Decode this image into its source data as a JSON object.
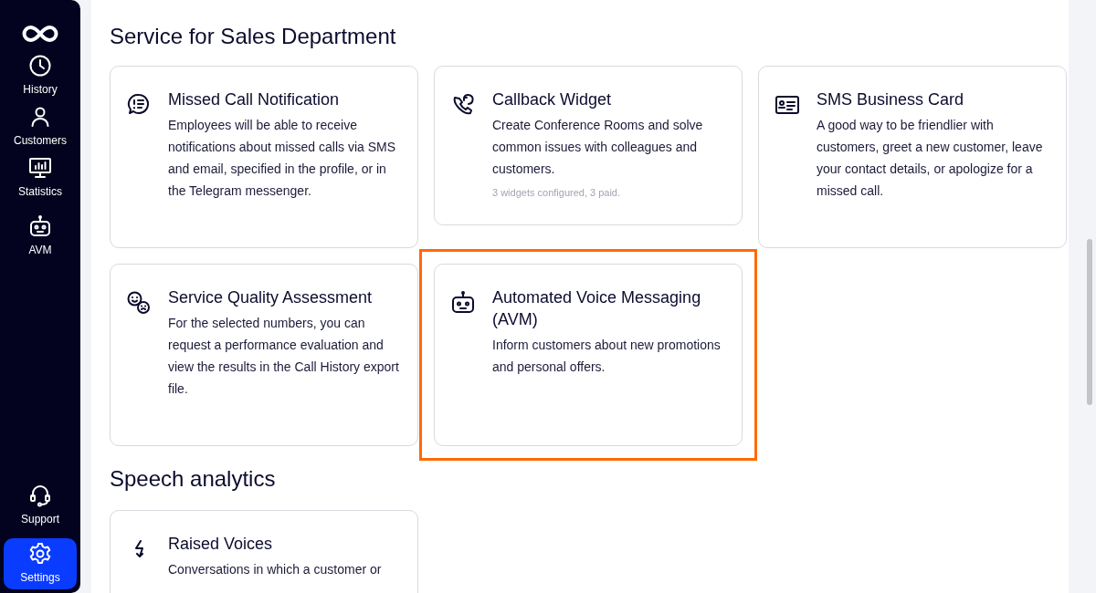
{
  "sidebar": {
    "items": [
      {
        "label": "History",
        "selected": false
      },
      {
        "label": "Customers",
        "selected": false
      },
      {
        "label": "Statistics",
        "selected": false
      },
      {
        "label": "AVM",
        "selected": false
      }
    ],
    "bottom_items": [
      {
        "label": "Support",
        "selected": false
      },
      {
        "label": "Settings",
        "selected": true
      }
    ]
  },
  "sections": [
    {
      "title": "Service for Sales Department",
      "cards": [
        {
          "title": "Missed Call Notification",
          "description": "Employees will be able to receive notifications about missed calls via SMS and email, specified in the profile, or in the Telegram messenger.",
          "highlighted": false
        },
        {
          "title": "Callback Widget",
          "description": "Create Conference Rooms and solve common issues with colleagues and customers.",
          "note": "3 widgets configured, 3 paid.",
          "highlighted": false
        },
        {
          "title": "SMS Business Card",
          "description": "A good way to be friendlier with customers, greet a new customer, leave your contact details, or apologize for a missed call.",
          "highlighted": false
        },
        {
          "title": "Service Quality Assessment",
          "description": "For the selected numbers, you can request a performance evaluation and view the results in the Call History export file.",
          "highlighted": false
        },
        {
          "title": "Automated Voice Messaging (AVM)",
          "description": "Inform customers about new promotions and personal offers.",
          "highlighted": true
        }
      ]
    },
    {
      "title": "Speech analytics",
      "cards": [
        {
          "title": "Raised Voices",
          "description": "Conversations in which a customer or",
          "highlighted": false
        }
      ]
    }
  ]
}
